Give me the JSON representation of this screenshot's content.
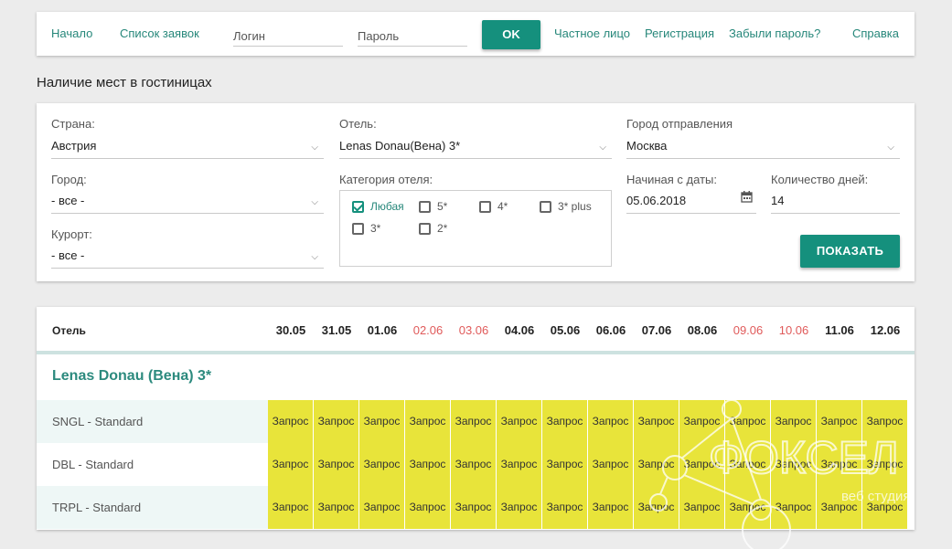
{
  "nav": {
    "home": "Начало",
    "requests": "Список заявок",
    "login_placeholder": "Логин",
    "password_placeholder": "Пароль",
    "ok": "OK",
    "private_person": "Частное лицо",
    "registration": "Регистрация",
    "forgot": "Забыли пароль?",
    "help": "Справка"
  },
  "page_title": "Наличие мест в гостиницах",
  "filters": {
    "country_label": "Страна:",
    "country_value": "Австрия",
    "city_label": "Город:",
    "city_value": "- все -",
    "resort_label": "Курорт:",
    "resort_value": "- все -",
    "hotel_label": "Отель:",
    "hotel_value": "Lenas Donau(Вена) 3*",
    "category_label": "Категория отеля:",
    "categories": [
      "Любая",
      "5*",
      "4*",
      "3* plus",
      "3*",
      "2*"
    ],
    "departure_label": "Город отправления",
    "departure_value": "Москва",
    "date_label": "Начиная с даты:",
    "date_value": "05.06.2018",
    "days_label": "Количество дней:",
    "days_value": "14",
    "show_button": "ПОКАЗАТЬ"
  },
  "table": {
    "hotel_col": "Отель",
    "dates": [
      "30.05",
      "31.05",
      "01.06",
      "02.06",
      "03.06",
      "04.06",
      "05.06",
      "06.06",
      "07.06",
      "08.06",
      "09.06",
      "10.06",
      "11.06",
      "12.06"
    ],
    "weekend_color": "#e05a5a",
    "hotel_name": "Lenas Donau (Вена) 3*",
    "rooms": [
      "SNGL - Standard",
      "DBL - Standard",
      "TRPL - Standard"
    ],
    "cell_label": "Запрос",
    "cell_color": "#e8e43a"
  },
  "watermark": {
    "brand": "ФОКСЕЛ",
    "tagline": "веб студия"
  },
  "colors": {
    "accent": "#15907d",
    "link": "#26877a"
  }
}
